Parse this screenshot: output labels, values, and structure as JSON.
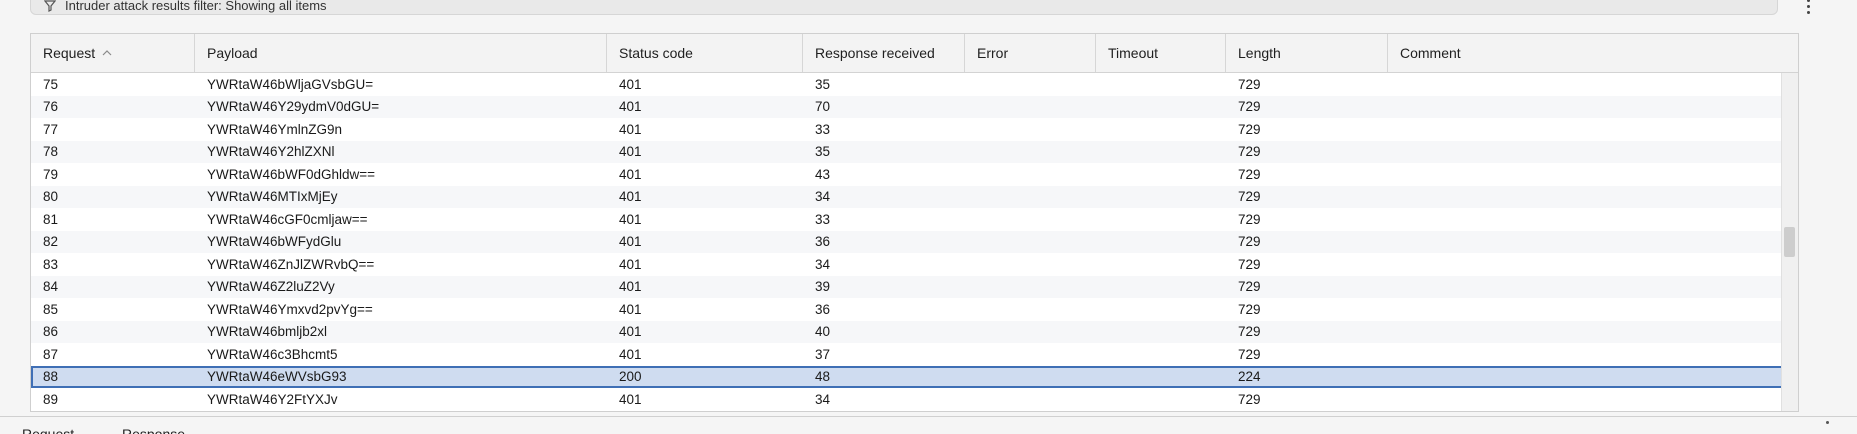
{
  "filter_bar": {
    "text": "Intruder attack results filter: Showing all items"
  },
  "table": {
    "columns": [
      {
        "key": "request",
        "label": "Request",
        "sorted": "ascending"
      },
      {
        "key": "payload",
        "label": "Payload"
      },
      {
        "key": "status",
        "label": "Status code"
      },
      {
        "key": "received",
        "label": "Response received"
      },
      {
        "key": "error",
        "label": "Error"
      },
      {
        "key": "timeout",
        "label": "Timeout"
      },
      {
        "key": "length",
        "label": "Length"
      },
      {
        "key": "comment",
        "label": "Comment"
      }
    ],
    "rows": [
      {
        "request": "75",
        "payload": "YWRtaW46bWljaGVsbGU=",
        "status": "401",
        "received": "35",
        "error": "",
        "timeout": "",
        "length": "729",
        "comment": ""
      },
      {
        "request": "76",
        "payload": "YWRtaW46Y29ydmV0dGU=",
        "status": "401",
        "received": "70",
        "error": "",
        "timeout": "",
        "length": "729",
        "comment": ""
      },
      {
        "request": "77",
        "payload": "YWRtaW46YmlnZG9n",
        "status": "401",
        "received": "33",
        "error": "",
        "timeout": "",
        "length": "729",
        "comment": ""
      },
      {
        "request": "78",
        "payload": "YWRtaW46Y2hlZXNl",
        "status": "401",
        "received": "35",
        "error": "",
        "timeout": "",
        "length": "729",
        "comment": ""
      },
      {
        "request": "79",
        "payload": "YWRtaW46bWF0dGhldw==",
        "status": "401",
        "received": "43",
        "error": "",
        "timeout": "",
        "length": "729",
        "comment": ""
      },
      {
        "request": "80",
        "payload": "YWRtaW46MTIxMjEy",
        "status": "401",
        "received": "34",
        "error": "",
        "timeout": "",
        "length": "729",
        "comment": ""
      },
      {
        "request": "81",
        "payload": "YWRtaW46cGF0cmljaw==",
        "status": "401",
        "received": "33",
        "error": "",
        "timeout": "",
        "length": "729",
        "comment": ""
      },
      {
        "request": "82",
        "payload": "YWRtaW46bWFydGlu",
        "status": "401",
        "received": "36",
        "error": "",
        "timeout": "",
        "length": "729",
        "comment": ""
      },
      {
        "request": "83",
        "payload": "YWRtaW46ZnJlZWRvbQ==",
        "status": "401",
        "received": "34",
        "error": "",
        "timeout": "",
        "length": "729",
        "comment": ""
      },
      {
        "request": "84",
        "payload": "YWRtaW46Z2luZ2Vy",
        "status": "401",
        "received": "39",
        "error": "",
        "timeout": "",
        "length": "729",
        "comment": ""
      },
      {
        "request": "85",
        "payload": "YWRtaW46Ymxvd2pvYg==",
        "status": "401",
        "received": "36",
        "error": "",
        "timeout": "",
        "length": "729",
        "comment": ""
      },
      {
        "request": "86",
        "payload": "YWRtaW46bmljb2xl",
        "status": "401",
        "received": "40",
        "error": "",
        "timeout": "",
        "length": "729",
        "comment": ""
      },
      {
        "request": "87",
        "payload": "YWRtaW46c3Bhcmt5",
        "status": "401",
        "received": "37",
        "error": "",
        "timeout": "",
        "length": "729",
        "comment": ""
      },
      {
        "request": "88",
        "payload": "YWRtaW46eWVsbG93",
        "status": "200",
        "received": "48",
        "error": "",
        "timeout": "",
        "length": "224",
        "comment": "",
        "selected": true
      },
      {
        "request": "89",
        "payload": "YWRtaW46Y2FtYXJv",
        "status": "401",
        "received": "34",
        "error": "",
        "timeout": "",
        "length": "729",
        "comment": ""
      }
    ]
  },
  "bottom_tabs": [
    {
      "label": "Request"
    },
    {
      "label": "Response"
    }
  ],
  "colors": {
    "selected_row_bg": "#cfdcf0",
    "selected_row_border": "#3f6fb5",
    "alt_row_bg": "#f6f7f9",
    "header_bg": "#f3f3f3"
  },
  "icons": {
    "filter": "filter-funnel-icon",
    "sort": "sort-ascending-icon",
    "menu": "more-vertical-icon"
  }
}
